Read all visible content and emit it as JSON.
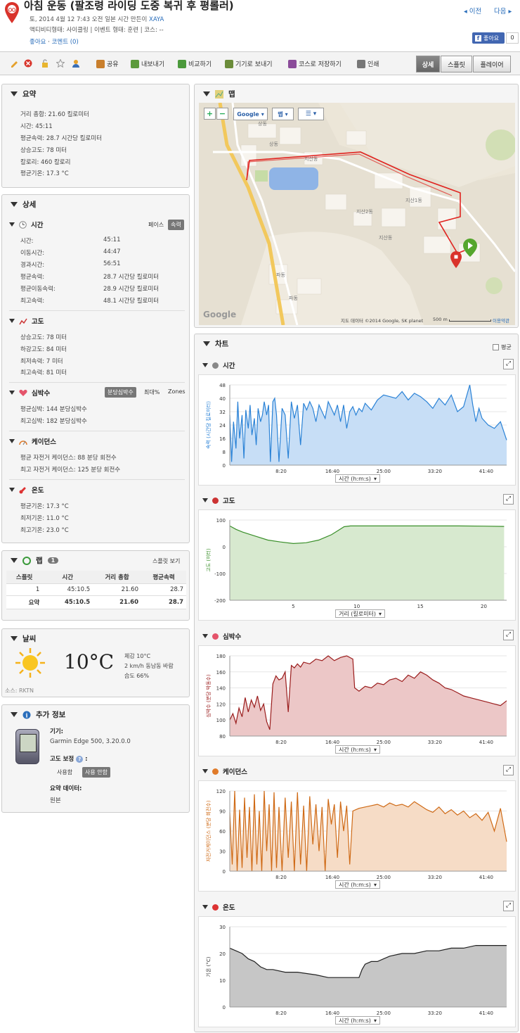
{
  "header": {
    "title": "아침 운동 (팔조령 라이딩 도중 복귀 후 평롤러)",
    "date_prefix": "토, 2014 4월 12 7:43 오전 일본 시간 만든이",
    "author": "XAYA",
    "meta_line": "액티비티형태: 사이클링 | 이벤트 형태: 훈련 | 코스: --",
    "like_link": "좋아요",
    "comment_link": "코멘트 (0)",
    "prev": "◂ 이전",
    "next": "다음 ▸",
    "fb_like": "좋아요",
    "fb_count": "0"
  },
  "toolbar": {
    "share": "공유",
    "export": "내보내기",
    "compare": "비교하기",
    "send_device": "기기로 보내기",
    "save_course": "코스로 저장하기",
    "print": "인쇄",
    "tabs": [
      "상세",
      "스플릿",
      "플레이어"
    ]
  },
  "summary": {
    "title": "요약",
    "rows": [
      "거리 총합: 21.60 킬로미터",
      "시간: 45:11",
      "평균속력: 28.7 시간당 킬로미터",
      "상승고도: 78 미터",
      "칼로리: 460 칼로리",
      "평균기온: 17.3 °C"
    ]
  },
  "detail": {
    "title": "상세",
    "time": {
      "title": "시간",
      "pace": "페이스",
      "speed": "속력",
      "rows": [
        [
          "시간:",
          "45:11"
        ],
        [
          "이동시간:",
          "44:47"
        ],
        [
          "경과시간:",
          "56:51"
        ],
        [
          "평균속력:",
          "28.7 시간당 킬로미터"
        ],
        [
          "평균이동속력:",
          "28.9 시간당 킬로미터"
        ],
        [
          "최고속력:",
          "48.1 시간당 킬로미터"
        ]
      ]
    },
    "elev": {
      "title": "고도",
      "rows": [
        "상승고도: 78 미터",
        "하강고도: 84 미터",
        "최저속력: 7 미터",
        "최고속력: 81 미터"
      ]
    },
    "hr": {
      "title": "심박수",
      "bpm": "분당심박수",
      "max": "최대%",
      "zones": "Zones",
      "rows": [
        "평균심박: 144 분당심박수",
        "최고심박: 182 분당심박수"
      ]
    },
    "cad": {
      "title": "케이던스",
      "rows": [
        "평균 자전거 케이던스: 88 분당 회전수",
        "최고 자전거 케이던스: 125 분당 회전수"
      ]
    },
    "temp": {
      "title": "온도",
      "rows": [
        "평균기온: 17.3 °C",
        "최저기온: 11.0 °C",
        "최고기온: 23.0 °C"
      ]
    }
  },
  "laps": {
    "title": "랩",
    "count": "1",
    "splits_link": "스플릿 보기",
    "headers": [
      "스플릿",
      "시간",
      "거리 총합",
      "평균속력"
    ],
    "rows": [
      [
        "1",
        "45:10.5",
        "21.60",
        "28.7"
      ]
    ],
    "total": [
      "요약",
      "45:10.5",
      "21.60",
      "28.7"
    ]
  },
  "weather": {
    "title": "날씨",
    "temp": "10°C",
    "feels": "체감 10°C",
    "wind": "2 km/h 동남동 바람",
    "humidity": "습도 66%",
    "source": "소스: RKTN"
  },
  "extra": {
    "title": "추가 정보",
    "device_label": "기기:",
    "device": "Garmin Edge 500, 3.20.0.0",
    "elev_corr": "고도 보정",
    "use": "사용함",
    "no_use": "사용 안함",
    "summary_label": "요약 데이터:",
    "summary_val": "원본"
  },
  "map": {
    "title": "맵",
    "google_btn": "Google",
    "map_btn": "맵",
    "labels": [
      "상동",
      "상동",
      "지산동",
      "지산1동",
      "지산2동",
      "지산동",
      "파동",
      "파동"
    ],
    "attribution": "지도 데이터 ©2014 Google, SK planet",
    "scale": "500 m",
    "terms": "이용약관",
    "logo": "Google"
  },
  "charts": {
    "title": "차트",
    "avg_label": "평균"
  },
  "chart_data": [
    {
      "type": "area",
      "title": "시간",
      "ylabel": "속력 (시간당 킬로미터)",
      "xlabel": "시간 (h:m:s)",
      "ylim": [
        0,
        48
      ],
      "yticks": [
        0,
        8,
        16,
        24,
        32,
        40,
        48
      ],
      "xticks": [
        "8:20",
        "16:40",
        "25:00",
        "33:20",
        "41:40"
      ],
      "x": [
        0,
        0.3,
        0.6,
        1,
        1.3,
        1.6,
        2,
        2.3,
        2.6,
        3,
        3.3,
        3.6,
        4,
        4.3,
        4.6,
        5,
        5.3,
        5.6,
        6,
        6.3,
        6.6,
        7,
        7.3,
        7.6,
        8,
        8.5,
        9,
        9.5,
        10,
        10.5,
        11,
        11.5,
        12,
        12.5,
        13,
        13.5,
        14,
        14.5,
        15,
        15.5,
        16,
        16.5,
        17,
        17.5,
        18,
        18.5,
        19,
        19.5,
        20,
        20.5,
        21,
        21.5,
        22,
        23,
        24,
        25,
        26,
        27,
        28,
        29,
        30,
        31,
        32,
        33,
        34,
        35,
        36,
        37,
        38,
        39,
        39.5,
        40,
        40.5,
        41,
        42,
        43,
        44,
        45
      ],
      "values": [
        30,
        2,
        26,
        10,
        38,
        16,
        30,
        4,
        33,
        22,
        36,
        18,
        28,
        12,
        34,
        26,
        30,
        38,
        30,
        36,
        2,
        38,
        40,
        30,
        2,
        34,
        30,
        4,
        38,
        28,
        36,
        12,
        37,
        33,
        38,
        34,
        26,
        36,
        32,
        28,
        38,
        34,
        30,
        36,
        26,
        36,
        22,
        32,
        35,
        30,
        34,
        32,
        37,
        33,
        39,
        42,
        41,
        40,
        44,
        39,
        43,
        41,
        38,
        34,
        40,
        36,
        42,
        32,
        35,
        48,
        36,
        26,
        34,
        28,
        24,
        22,
        26,
        15
      ]
    },
    {
      "type": "area",
      "title": "고도",
      "ylabel": "고도 (미터)",
      "xlabel": "거리 (킬로미터)",
      "ylim": [
        -200,
        100
      ],
      "yticks": [
        -200,
        -100,
        0,
        100
      ],
      "xticks": [
        "5",
        "10",
        "15",
        "20"
      ],
      "x": [
        0,
        0.5,
        1,
        2,
        3,
        4,
        5,
        6,
        7,
        8,
        8.5,
        9,
        9.5,
        10,
        12,
        15,
        18,
        20,
        21.6
      ],
      "values": [
        78,
        65,
        55,
        40,
        25,
        18,
        12,
        15,
        25,
        45,
        60,
        75,
        78,
        78,
        78,
        78,
        78,
        77,
        76
      ]
    },
    {
      "type": "area",
      "title": "심박수",
      "ylabel": "심박수 (분당 박동수)",
      "xlabel": "시간 (h:m:s)",
      "ylim": [
        80,
        180
      ],
      "yticks": [
        80,
        100,
        120,
        140,
        160,
        180
      ],
      "xticks": [
        "8:20",
        "16:40",
        "25:00",
        "33:20",
        "41:40"
      ],
      "x": [
        0,
        0.5,
        1,
        1.5,
        2,
        2.5,
        3,
        3.5,
        4,
        4.5,
        5,
        5.5,
        6,
        6.5,
        7,
        7.5,
        8,
        8.5,
        9,
        9.5,
        10,
        10.5,
        11,
        11.5,
        12,
        13,
        14,
        15,
        16,
        17,
        18,
        19,
        20,
        20.3,
        21,
        22,
        23,
        24,
        25,
        26,
        27,
        28,
        29,
        30,
        31,
        32,
        33,
        34,
        35,
        36,
        37,
        38,
        39,
        40,
        41,
        42,
        43,
        44,
        45
      ],
      "values": [
        100,
        108,
        96,
        115,
        104,
        128,
        110,
        125,
        116,
        130,
        112,
        120,
        98,
        88,
        145,
        155,
        150,
        152,
        160,
        110,
        168,
        165,
        170,
        166,
        172,
        170,
        176,
        174,
        180,
        174,
        178,
        182,
        176,
        140,
        136,
        142,
        140,
        146,
        144,
        150,
        152,
        148,
        156,
        152,
        160,
        156,
        150,
        146,
        140,
        138,
        134,
        130,
        128,
        126,
        124,
        122,
        120,
        118,
        124
      ]
    },
    {
      "type": "area",
      "title": "케이던스",
      "ylabel": "자전거케이던스 (분당 회전수)",
      "xlabel": "시간 (h:m:s)",
      "ylim": [
        0,
        120
      ],
      "yticks": [
        0,
        30,
        60,
        90,
        120
      ],
      "xticks": [
        "8:20",
        "16:40",
        "25:00",
        "33:20",
        "41:40"
      ],
      "x": [
        0,
        0.4,
        0.8,
        1.2,
        1.6,
        2,
        2.4,
        2.8,
        3.2,
        3.6,
        4,
        4.4,
        4.8,
        5.2,
        5.6,
        6,
        6.4,
        6.8,
        7.2,
        7.6,
        8,
        8.5,
        9,
        9.5,
        10,
        10.5,
        11,
        11.5,
        12,
        12.5,
        13,
        13.5,
        14,
        14.5,
        15,
        15.5,
        16,
        16.5,
        17,
        17.5,
        18,
        18.5,
        19,
        19.5,
        20,
        20.5,
        21,
        22,
        23,
        24,
        25,
        26,
        27,
        28,
        29,
        30,
        31,
        32,
        33,
        34,
        35,
        36,
        37,
        38,
        39,
        40,
        41,
        42,
        43,
        44,
        45
      ],
      "values": [
        88,
        10,
        120,
        0,
        92,
        5,
        110,
        20,
        96,
        0,
        115,
        10,
        90,
        0,
        125,
        30,
        100,
        0,
        118,
        5,
        96,
        0,
        110,
        20,
        104,
        0,
        118,
        10,
        98,
        0,
        112,
        40,
        100,
        30,
        96,
        0,
        108,
        70,
        100,
        20,
        104,
        60,
        98,
        10,
        90,
        92,
        94,
        96,
        98,
        100,
        96,
        102,
        98,
        100,
        96,
        104,
        98,
        92,
        88,
        96,
        86,
        92,
        84,
        90,
        80,
        86,
        76,
        88,
        60,
        94,
        44
      ]
    },
    {
      "type": "area",
      "title": "온도",
      "ylabel": "기온 (°C)",
      "xlabel": "시간 (h:m:s)",
      "ylim": [
        0,
        30
      ],
      "yticks": [
        0,
        10,
        20,
        30
      ],
      "xticks": [
        "8:20",
        "16:40",
        "25:00",
        "33:20",
        "41:40"
      ],
      "x": [
        0,
        1,
        2,
        3,
        4,
        5,
        6,
        7,
        9,
        11,
        14,
        16,
        19,
        21,
        21.5,
        22,
        23,
        24,
        25,
        26,
        28,
        30,
        32,
        34,
        36,
        38,
        40,
        45
      ],
      "values": [
        22,
        21,
        20,
        18,
        17,
        15,
        14,
        14,
        13,
        13,
        12,
        11,
        11,
        11,
        14,
        16,
        17,
        17,
        18,
        19,
        20,
        20,
        21,
        21,
        22,
        22,
        23,
        23
      ]
    }
  ]
}
